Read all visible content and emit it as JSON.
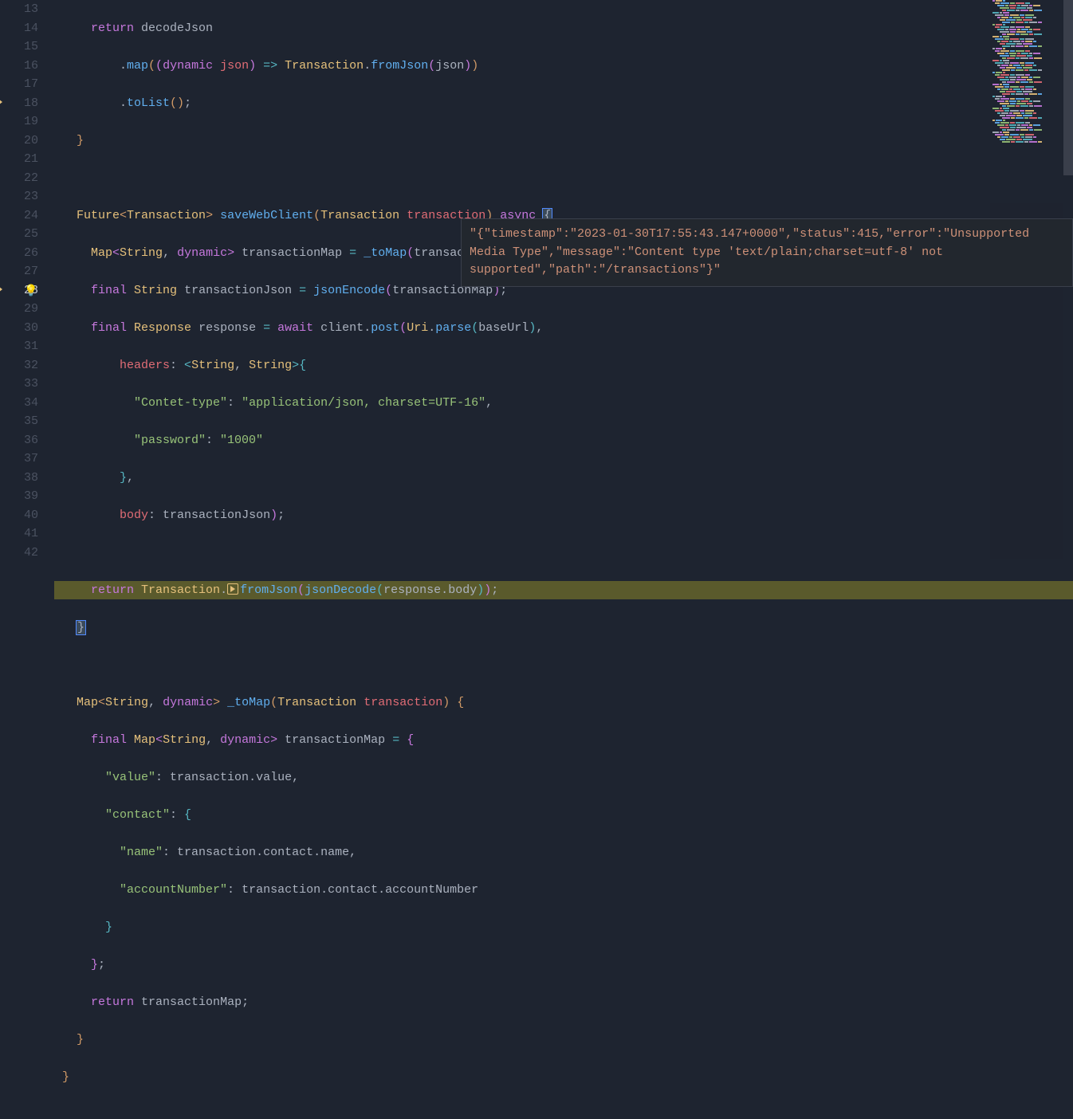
{
  "lines": {
    "start": 13,
    "active": 28,
    "numbers": [
      13,
      14,
      15,
      16,
      17,
      18,
      19,
      20,
      21,
      22,
      23,
      24,
      25,
      26,
      27,
      28,
      29,
      30,
      31,
      32,
      33,
      34,
      35,
      36,
      37,
      38,
      39,
      40,
      41,
      42
    ]
  },
  "code": {
    "l13": {
      "return": "return",
      "decodeJson": "decodeJson"
    },
    "l14": {
      "map": "map",
      "dynamic": "dynamic",
      "json": "json",
      "Transaction": "Transaction",
      "fromJson": "fromJson",
      "json2": "json"
    },
    "l15": {
      "toList": "toList"
    },
    "l18": {
      "Future": "Future",
      "Transaction": "Transaction",
      "saveWebClient": "saveWebClient",
      "Transaction2": "Transaction",
      "transaction": "transaction",
      "async": "async"
    },
    "l19": {
      "Map": "Map",
      "String": "String",
      "dynamic": "dynamic",
      "transactionMap": "transactionMap",
      "toMap": "_toMap",
      "transaction": "transaction"
    },
    "l20": {
      "final": "final",
      "String": "String",
      "transactionJson": "transactionJson",
      "jsonEncode": "jsonEncode",
      "transactionMap": "transactionMap"
    },
    "l21": {
      "final": "final",
      "Response": "Response",
      "response": "response",
      "await": "await",
      "client": "client",
      "post": "post",
      "Uri": "Uri",
      "parse": "parse",
      "baseUrl": "baseUrl"
    },
    "l22": {
      "headers": "headers",
      "String": "String",
      "String2": "String"
    },
    "l23": {
      "k": "\"Contet-type\"",
      "v": "\"application/json, charset=UTF-16\""
    },
    "l24": {
      "k": "\"password\"",
      "v": "\"1000\""
    },
    "l26": {
      "body": "body",
      "transactionJson": "transactionJson"
    },
    "l28": {
      "return": "return",
      "Transaction": "Transaction",
      "fromJson": "fromJson",
      "jsonDecode": "jsonDecode",
      "response": "response",
      "body": "body"
    },
    "l31": {
      "Map": "Map",
      "String": "String",
      "dynamic": "dynamic",
      "toMap": "_toMap",
      "Transaction": "Transaction",
      "transaction": "transaction"
    },
    "l32": {
      "final": "final",
      "Map": "Map",
      "String": "String",
      "dynamic": "dynamic",
      "transactionMap": "transactionMap"
    },
    "l33": {
      "k": "\"value\"",
      "transaction": "transaction",
      "value": "value"
    },
    "l34": {
      "k": "\"contact\""
    },
    "l35": {
      "k": "\"name\"",
      "transaction": "transaction",
      "contact": "contact",
      "name": "name"
    },
    "l36": {
      "k": "\"accountNumber\"",
      "transaction": "transaction",
      "contact": "contact",
      "accountNumber": "accountNumber"
    },
    "l39": {
      "return": "return",
      "transactionMap": "transactionMap"
    }
  },
  "tooltip": "\"{\"timestamp\":\"2023-01-30T17:55:43.147+0000\",\"status\":415,\"error\":\"Unsupported Media Type\",\"message\":\"Content type 'text/plain;charset=utf-8' not supported\",\"path\":\"/transactions\"}\"",
  "minimap_colors": [
    "#c678dd",
    "#e5c07b",
    "#61afef",
    "#98c379",
    "#e06c75",
    "#56b6c2",
    "#abb2bf"
  ]
}
